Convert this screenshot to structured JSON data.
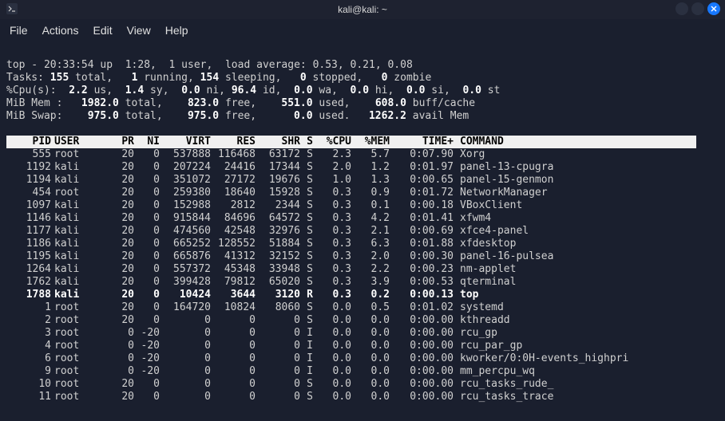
{
  "window": {
    "title": "kali@kali: ~"
  },
  "menu": {
    "file": "File",
    "actions": "Actions",
    "edit": "Edit",
    "view": "View",
    "help": "Help"
  },
  "summary": {
    "line1_prefix": "top - ",
    "time": "20:33:54",
    "up_label": " up  ",
    "uptime": "1:28",
    "users_sep": ",  ",
    "users": "1 user",
    "load_label": ",  load average: ",
    "load_avg": "0.53, 0.21, 0.08",
    "tasks_label": "Tasks: ",
    "tasks_total": "155",
    "total_label": " total,   ",
    "tasks_running": "1",
    "running_label": " running, ",
    "tasks_sleeping": "154",
    "sleeping_label": " sleeping,   ",
    "tasks_stopped": "0",
    "stopped_label": " stopped,   ",
    "tasks_zombie": "0",
    "zombie_label": " zombie",
    "cpu_label": "%Cpu(s):  ",
    "cpu_us": "2.2",
    "us_label": " us,  ",
    "cpu_sy": "1.4",
    "sy_label": " sy,  ",
    "cpu_ni": "0.0",
    "ni_label": " ni, ",
    "cpu_id": "96.4",
    "id_label": " id,  ",
    "cpu_wa": "0.0",
    "wa_label": " wa,  ",
    "cpu_hi": "0.0",
    "hi_label": " hi,  ",
    "cpu_si": "0.0",
    "si_label": " si,  ",
    "cpu_st": "0.0",
    "st_label": " st",
    "mem_label": "MiB Mem :   ",
    "mem_total": "1982.0",
    "mem_total_label": " total,    ",
    "mem_free": "823.0",
    "mem_free_label": " free,    ",
    "mem_used": "551.0",
    "mem_used_label": " used,    ",
    "mem_buff": "608.0",
    "mem_buff_label": " buff/cache",
    "swap_label": "MiB Swap:    ",
    "swap_total": "975.0",
    "swap_total_label": " total,    ",
    "swap_free": "975.0",
    "swap_free_label": " free,      ",
    "swap_used": "0.0",
    "swap_used_label": " used.   ",
    "swap_avail": "1262.2",
    "swap_avail_label": " avail Mem"
  },
  "headers": {
    "pid": "PID",
    "user": "USER",
    "pr": "PR",
    "ni": "NI",
    "virt": "VIRT",
    "res": "RES",
    "shr": "SHR",
    "s": "S",
    "cpu": "%CPU",
    "mem": "%MEM",
    "time": "TIME+",
    "cmd": "COMMAND"
  },
  "procs": [
    {
      "pid": "555",
      "user": "root",
      "pr": "20",
      "ni": "0",
      "virt": "537888",
      "res": "116468",
      "shr": "63172",
      "s": "S",
      "cpu": "2.3",
      "mem": "5.7",
      "time": "0:07.90",
      "cmd": "Xorg",
      "bold": false
    },
    {
      "pid": "1192",
      "user": "kali",
      "pr": "20",
      "ni": "0",
      "virt": "207224",
      "res": "24416",
      "shr": "17344",
      "s": "S",
      "cpu": "2.0",
      "mem": "1.2",
      "time": "0:01.97",
      "cmd": "panel-13-cpugra",
      "bold": false
    },
    {
      "pid": "1194",
      "user": "kali",
      "pr": "20",
      "ni": "0",
      "virt": "351072",
      "res": "27172",
      "shr": "19676",
      "s": "S",
      "cpu": "1.0",
      "mem": "1.3",
      "time": "0:00.65",
      "cmd": "panel-15-genmon",
      "bold": false
    },
    {
      "pid": "454",
      "user": "root",
      "pr": "20",
      "ni": "0",
      "virt": "259380",
      "res": "18640",
      "shr": "15928",
      "s": "S",
      "cpu": "0.3",
      "mem": "0.9",
      "time": "0:01.72",
      "cmd": "NetworkManager",
      "bold": false
    },
    {
      "pid": "1097",
      "user": "kali",
      "pr": "20",
      "ni": "0",
      "virt": "152988",
      "res": "2812",
      "shr": "2344",
      "s": "S",
      "cpu": "0.3",
      "mem": "0.1",
      "time": "0:00.18",
      "cmd": "VBoxClient",
      "bold": false
    },
    {
      "pid": "1146",
      "user": "kali",
      "pr": "20",
      "ni": "0",
      "virt": "915844",
      "res": "84696",
      "shr": "64572",
      "s": "S",
      "cpu": "0.3",
      "mem": "4.2",
      "time": "0:01.41",
      "cmd": "xfwm4",
      "bold": false
    },
    {
      "pid": "1177",
      "user": "kali",
      "pr": "20",
      "ni": "0",
      "virt": "474560",
      "res": "42548",
      "shr": "32976",
      "s": "S",
      "cpu": "0.3",
      "mem": "2.1",
      "time": "0:00.69",
      "cmd": "xfce4-panel",
      "bold": false
    },
    {
      "pid": "1186",
      "user": "kali",
      "pr": "20",
      "ni": "0",
      "virt": "665252",
      "res": "128552",
      "shr": "51884",
      "s": "S",
      "cpu": "0.3",
      "mem": "6.3",
      "time": "0:01.88",
      "cmd": "xfdesktop",
      "bold": false
    },
    {
      "pid": "1195",
      "user": "kali",
      "pr": "20",
      "ni": "0",
      "virt": "665876",
      "res": "41312",
      "shr": "32152",
      "s": "S",
      "cpu": "0.3",
      "mem": "2.0",
      "time": "0:00.30",
      "cmd": "panel-16-pulsea",
      "bold": false
    },
    {
      "pid": "1264",
      "user": "kali",
      "pr": "20",
      "ni": "0",
      "virt": "557372",
      "res": "45348",
      "shr": "33948",
      "s": "S",
      "cpu": "0.3",
      "mem": "2.2",
      "time": "0:00.23",
      "cmd": "nm-applet",
      "bold": false
    },
    {
      "pid": "1762",
      "user": "kali",
      "pr": "20",
      "ni": "0",
      "virt": "399428",
      "res": "79812",
      "shr": "65020",
      "s": "S",
      "cpu": "0.3",
      "mem": "3.9",
      "time": "0:00.53",
      "cmd": "qterminal",
      "bold": false
    },
    {
      "pid": "1788",
      "user": "kali",
      "pr": "20",
      "ni": "0",
      "virt": "10424",
      "res": "3644",
      "shr": "3120",
      "s": "R",
      "cpu": "0.3",
      "mem": "0.2",
      "time": "0:00.13",
      "cmd": "top",
      "bold": true
    },
    {
      "pid": "1",
      "user": "root",
      "pr": "20",
      "ni": "0",
      "virt": "164720",
      "res": "10824",
      "shr": "8060",
      "s": "S",
      "cpu": "0.0",
      "mem": "0.5",
      "time": "0:01.02",
      "cmd": "systemd",
      "bold": false
    },
    {
      "pid": "2",
      "user": "root",
      "pr": "20",
      "ni": "0",
      "virt": "0",
      "res": "0",
      "shr": "0",
      "s": "S",
      "cpu": "0.0",
      "mem": "0.0",
      "time": "0:00.00",
      "cmd": "kthreadd",
      "bold": false
    },
    {
      "pid": "3",
      "user": "root",
      "pr": "0",
      "ni": "-20",
      "virt": "0",
      "res": "0",
      "shr": "0",
      "s": "I",
      "cpu": "0.0",
      "mem": "0.0",
      "time": "0:00.00",
      "cmd": "rcu_gp",
      "bold": false
    },
    {
      "pid": "4",
      "user": "root",
      "pr": "0",
      "ni": "-20",
      "virt": "0",
      "res": "0",
      "shr": "0",
      "s": "I",
      "cpu": "0.0",
      "mem": "0.0",
      "time": "0:00.00",
      "cmd": "rcu_par_gp",
      "bold": false
    },
    {
      "pid": "6",
      "user": "root",
      "pr": "0",
      "ni": "-20",
      "virt": "0",
      "res": "0",
      "shr": "0",
      "s": "I",
      "cpu": "0.0",
      "mem": "0.0",
      "time": "0:00.00",
      "cmd": "kworker/0:0H-events_highpri",
      "bold": false
    },
    {
      "pid": "9",
      "user": "root",
      "pr": "0",
      "ni": "-20",
      "virt": "0",
      "res": "0",
      "shr": "0",
      "s": "I",
      "cpu": "0.0",
      "mem": "0.0",
      "time": "0:00.00",
      "cmd": "mm_percpu_wq",
      "bold": false
    },
    {
      "pid": "10",
      "user": "root",
      "pr": "20",
      "ni": "0",
      "virt": "0",
      "res": "0",
      "shr": "0",
      "s": "S",
      "cpu": "0.0",
      "mem": "0.0",
      "time": "0:00.00",
      "cmd": "rcu_tasks_rude_",
      "bold": false
    },
    {
      "pid": "11",
      "user": "root",
      "pr": "20",
      "ni": "0",
      "virt": "0",
      "res": "0",
      "shr": "0",
      "s": "S",
      "cpu": "0.0",
      "mem": "0.0",
      "time": "0:00.00",
      "cmd": "rcu_tasks_trace",
      "bold": false
    }
  ]
}
